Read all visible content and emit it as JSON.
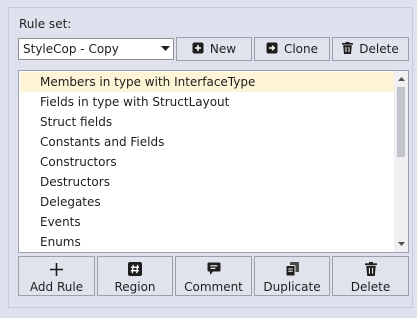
{
  "ruleset": {
    "label": "Rule set:",
    "selected": "StyleCop - Copy"
  },
  "toolbar": {
    "new_label": "New",
    "clone_label": "Clone",
    "delete_label": "Delete"
  },
  "rules": {
    "items": [
      "Members in type with InterfaceType",
      "Fields in type with StructLayout",
      "Struct fields",
      "Constants and Fields",
      "Constructors",
      "Destructors",
      "Delegates",
      "Events",
      "Enums"
    ],
    "selected_index": 0
  },
  "actions": {
    "add_rule_label": "Add Rule",
    "region_label": "Region",
    "comment_label": "Comment",
    "duplicate_label": "Duplicate",
    "delete_label": "Delete"
  },
  "colors": {
    "background": "#dfe2ee",
    "selected_row": "#fdf5d6",
    "button_face": "#e1e3ec"
  }
}
